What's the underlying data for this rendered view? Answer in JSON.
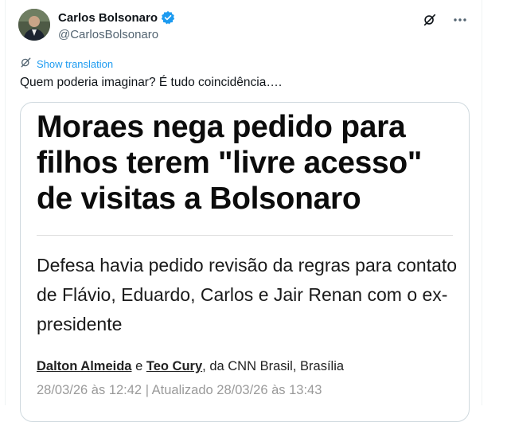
{
  "author": {
    "name": "Carlos Bolsonaro",
    "handle": "@CarlosBolsonaro",
    "verified_icon": "verified-badge-icon",
    "badge_color": "#1d9bf0"
  },
  "actions": {
    "grok_icon": "grok-icon",
    "more_icon": "more-icon"
  },
  "translation": {
    "label": "Show translation",
    "icon": "translate-icon"
  },
  "tweet": {
    "text": "Quem poderia imaginar? É tudo coincidência…."
  },
  "card": {
    "headline": "Moraes nega pedido para filhos terem \"livre acesso\" de visitas a Bolsonaro",
    "subheadline": "Defesa havia pedido revisão da regras para contato de Flávio, Eduardo, Carlos e Jair Renan com o ex-presidente",
    "byline": {
      "author1": "Dalton Almeida",
      "and": " e ",
      "author2": "Teo Cury",
      "suffix": ", da CNN Brasil, Brasília"
    },
    "dateline": "28/03/26 às 12:42 | Atualizado 28/03/26 às 13:43"
  }
}
